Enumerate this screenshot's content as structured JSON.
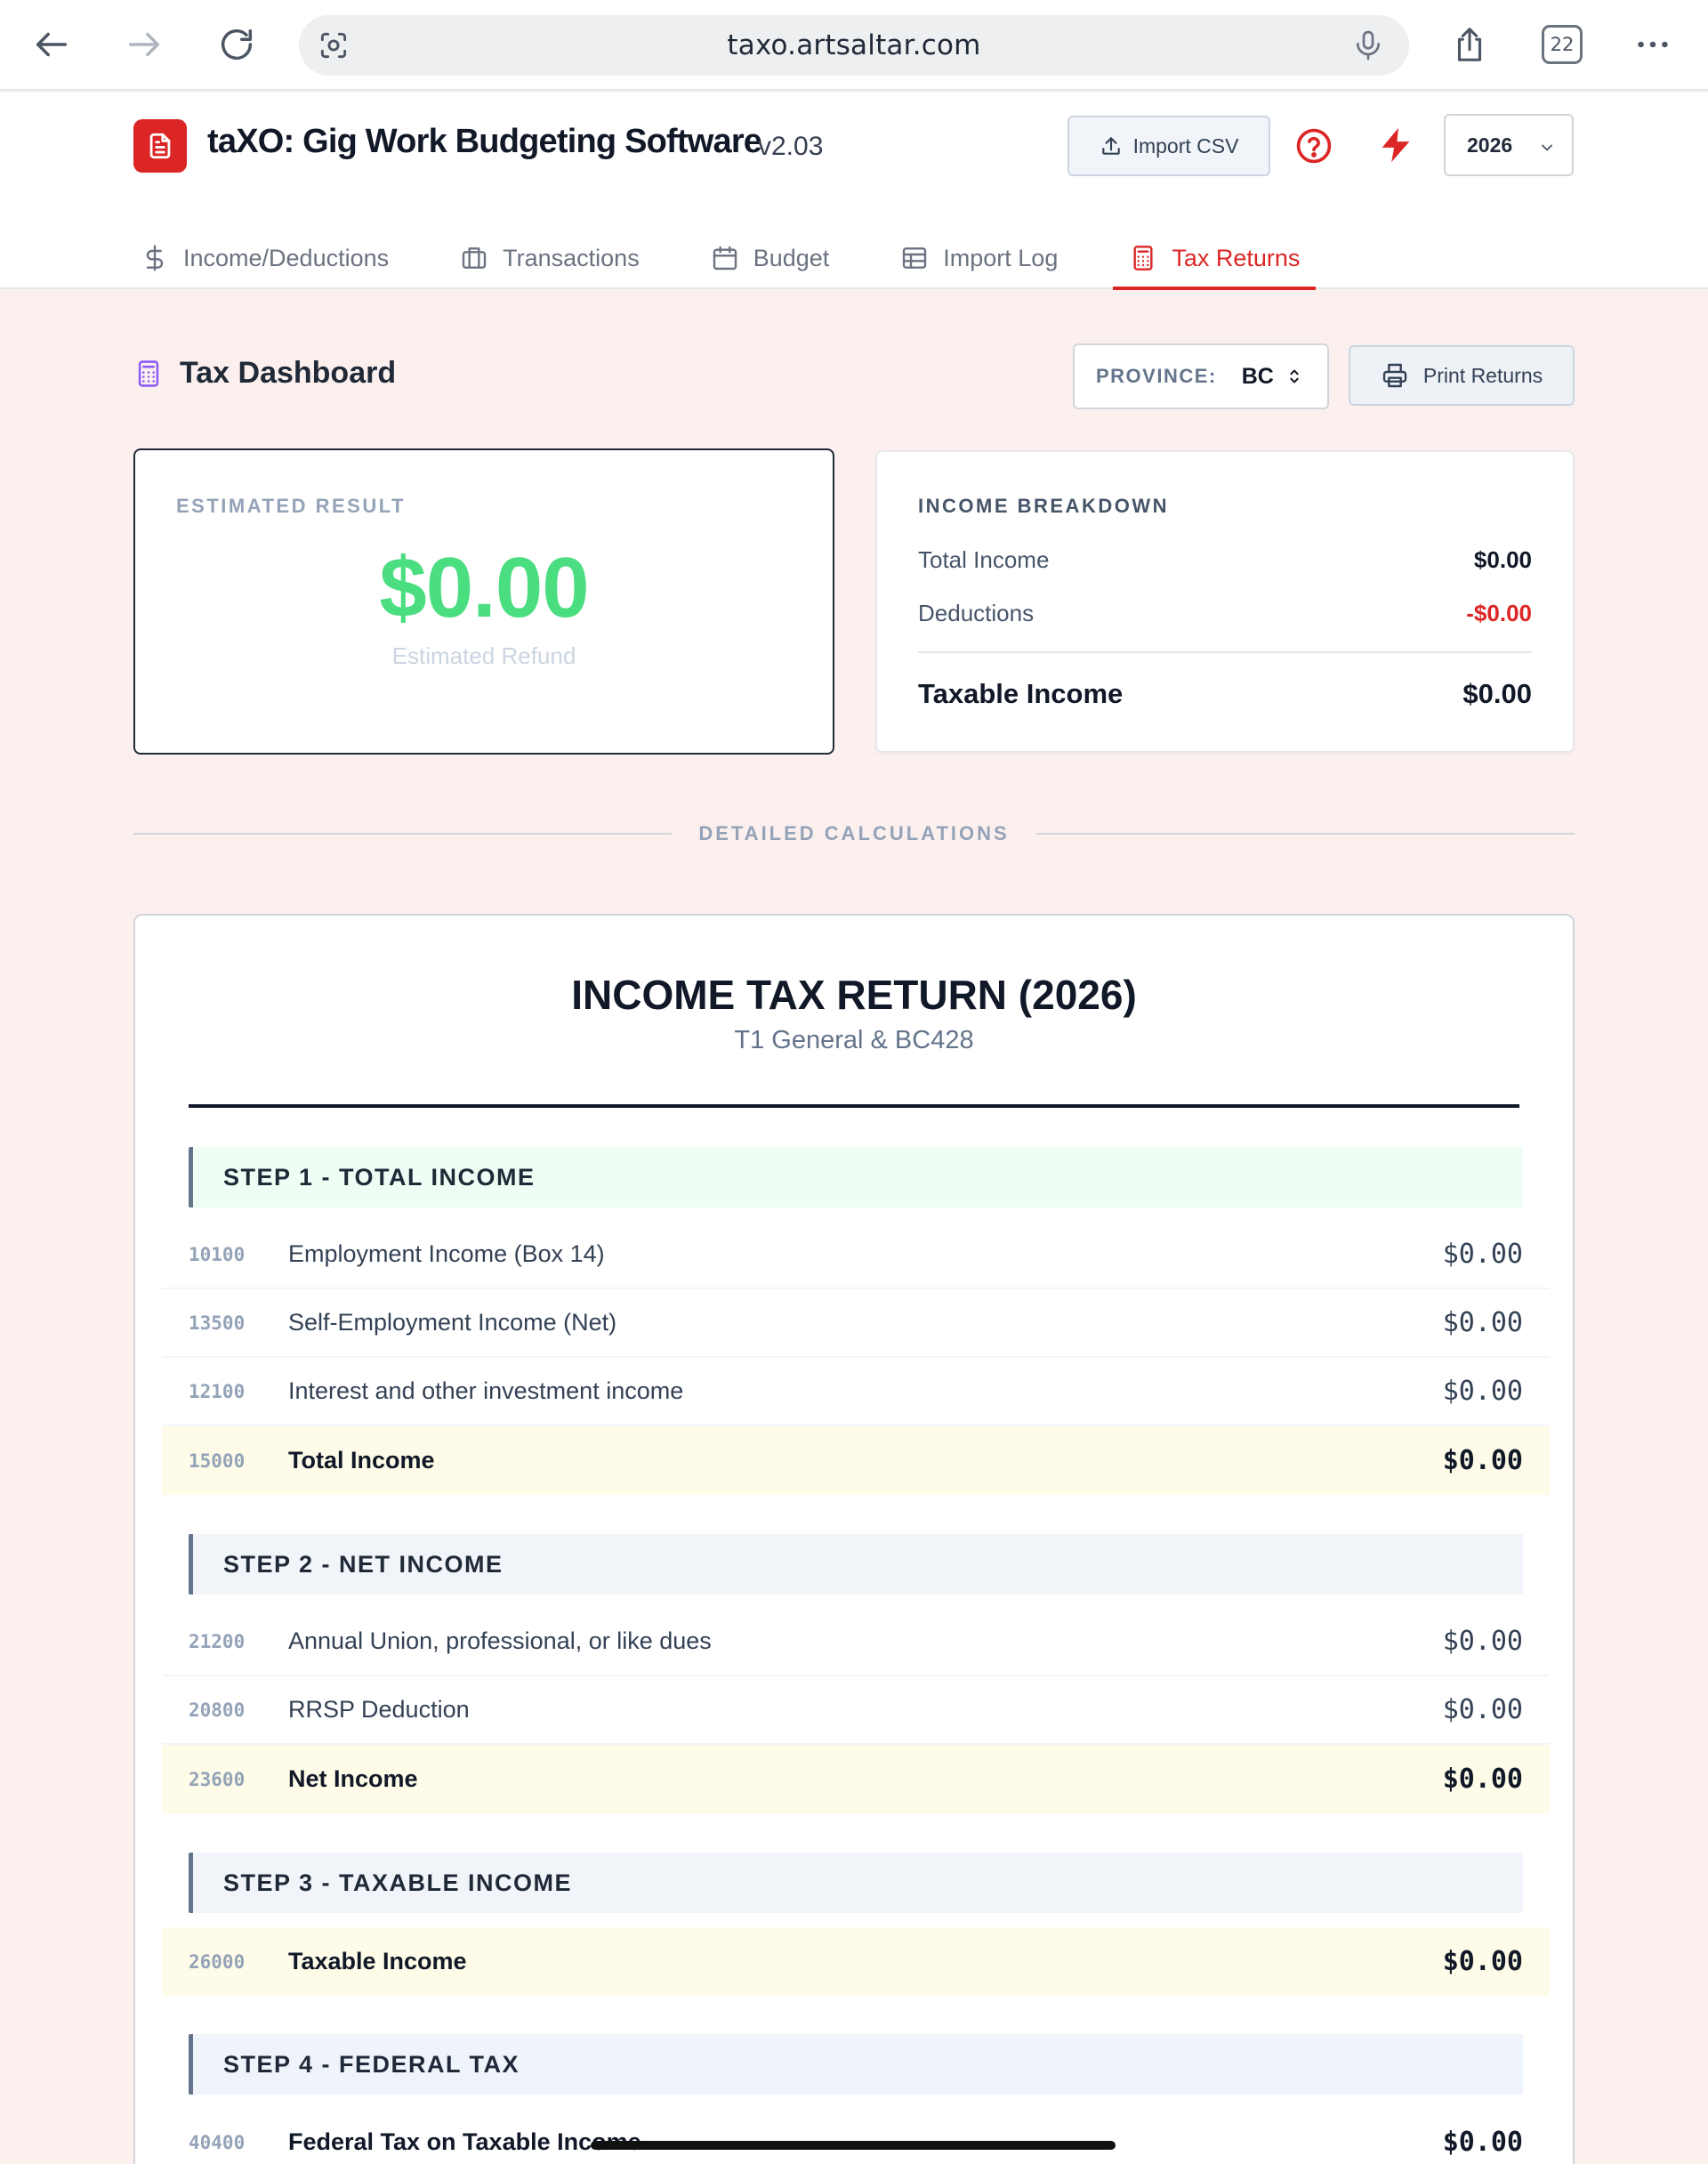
{
  "browser": {
    "url": "taxo.artsaltar.com",
    "tab_count": "22"
  },
  "app": {
    "title": "taXO: Gig Work Budgeting Software",
    "version": "v2.03",
    "import_label": "Import CSV",
    "year": "2026",
    "accent_color": "#dc2626"
  },
  "tabs": [
    {
      "label": "Income/Deductions",
      "icon": "dollar-icon"
    },
    {
      "label": "Transactions",
      "icon": "briefcase-icon"
    },
    {
      "label": "Budget",
      "icon": "calendar-icon"
    },
    {
      "label": "Import Log",
      "icon": "table-icon"
    },
    {
      "label": "Tax Returns",
      "icon": "calculator-icon",
      "active": true
    }
  ],
  "dashboard": {
    "title": "Tax Dashboard",
    "province_label": "PROVINCE:",
    "province_value": "BC",
    "print_label": "Print Returns"
  },
  "result": {
    "label": "ESTIMATED RESULT",
    "amount": "$0.00",
    "sublabel": "Estimated Refund"
  },
  "breakdown": {
    "label": "INCOME BREAKDOWN",
    "rows": [
      {
        "label": "Total Income",
        "value": "$0.00"
      },
      {
        "label": "Deductions",
        "value": "-$0.00"
      }
    ],
    "total_label": "Taxable Income",
    "total_value": "$0.00"
  },
  "separator": "DETAILED CALCULATIONS",
  "return": {
    "title": "INCOME TAX RETURN (2026)",
    "subtitle": "T1 General & BC428",
    "steps": [
      {
        "title": "STEP 1 - TOTAL INCOME"
      },
      {
        "title": "STEP 2 - NET INCOME"
      },
      {
        "title": "STEP 3 - TAXABLE INCOME"
      },
      {
        "title": "STEP 4 - FEDERAL TAX"
      }
    ],
    "lines": [
      {
        "code": "10100",
        "desc": "Employment Income (Box 14)",
        "amount": "$0.00"
      },
      {
        "code": "13500",
        "desc": "Self-Employment Income (Net)",
        "amount": "$0.00"
      },
      {
        "code": "12100",
        "desc": "Interest and other investment income",
        "amount": "$0.00"
      },
      {
        "code": "15000",
        "desc": "Total Income",
        "amount": "$0.00"
      },
      {
        "code": "21200",
        "desc": "Annual Union, professional, or like dues",
        "amount": "$0.00"
      },
      {
        "code": "20800",
        "desc": "RRSP Deduction",
        "amount": "$0.00"
      },
      {
        "code": "23600",
        "desc": "Net Income",
        "amount": "$0.00"
      },
      {
        "code": "26000",
        "desc": "Taxable Income",
        "amount": "$0.00"
      },
      {
        "code": "40400",
        "desc": "Federal Tax on Taxable Income",
        "amount": "$0.00"
      }
    ]
  }
}
